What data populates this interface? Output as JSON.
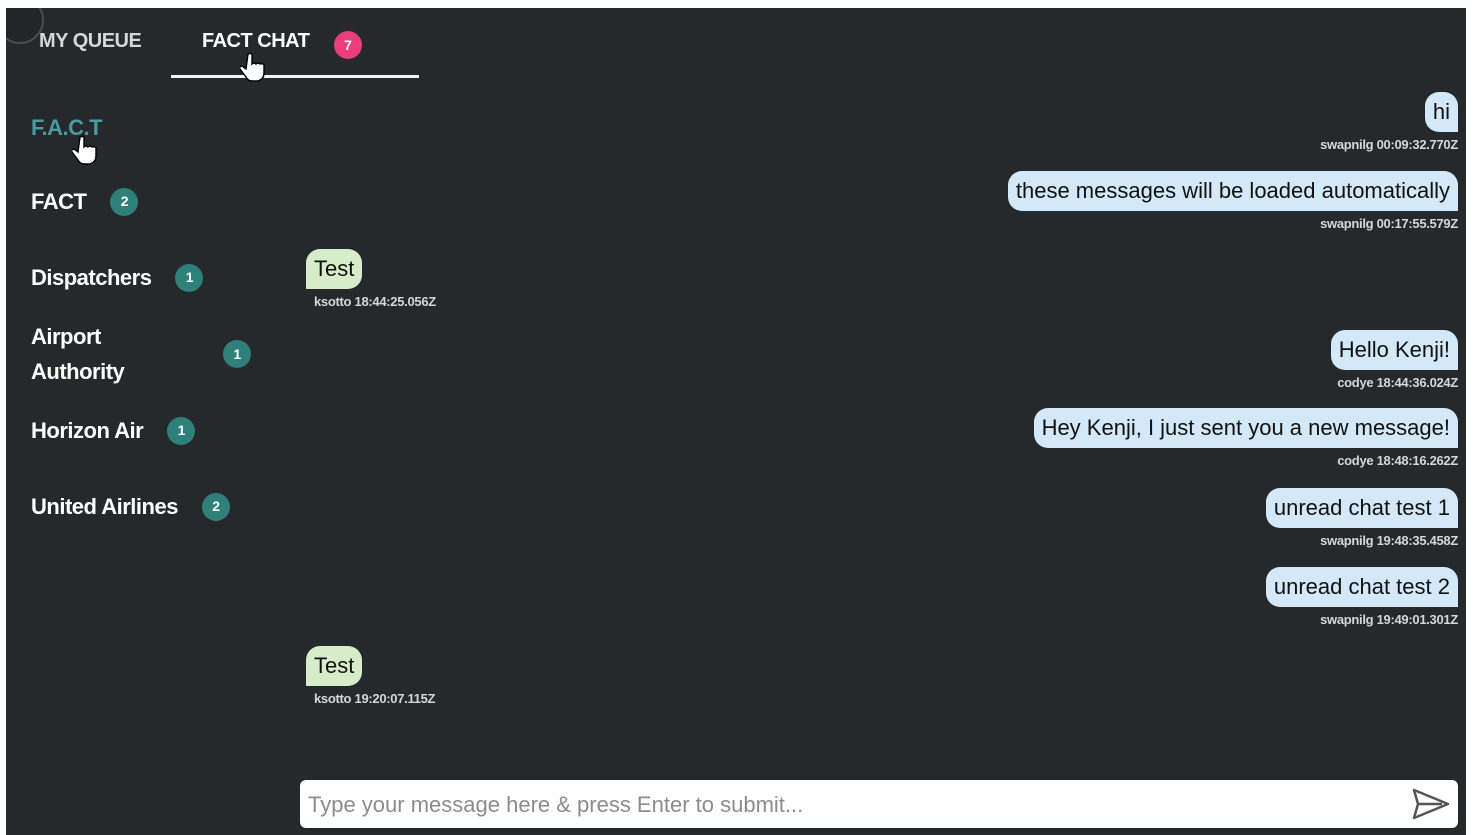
{
  "tabs": {
    "queue_label": "MY QUEUE",
    "chat_label": "FACT CHAT",
    "chat_badge": "7"
  },
  "sidebar": {
    "items": [
      {
        "label": "F.A.C.T",
        "count": null,
        "active": true
      },
      {
        "label": "FACT",
        "count": "2"
      },
      {
        "label": "Dispatchers",
        "count": "1"
      },
      {
        "label": "Airport Authority",
        "count": "1"
      },
      {
        "label": "Horizon Air",
        "count": "1"
      },
      {
        "label": "United Airlines",
        "count": "2"
      }
    ]
  },
  "messages": [
    {
      "text": "hi",
      "meta": "swapnilg 00:09:32.770Z",
      "side": "right"
    },
    {
      "text": "these messages will be loaded automatically",
      "meta": "swapnilg 00:17:55.579Z",
      "side": "right"
    },
    {
      "text": "Test",
      "meta": "ksotto 18:44:25.056Z",
      "side": "left"
    },
    {
      "text": "Hello Kenji!",
      "meta": "codye 18:44:36.024Z",
      "side": "right"
    },
    {
      "text": "Hey Kenji, I just sent you a new message!",
      "meta": "codye 18:48:16.262Z",
      "side": "right"
    },
    {
      "text": "unread chat test 1",
      "meta": "swapnilg 19:48:35.458Z",
      "side": "right"
    },
    {
      "text": "unread chat test 2",
      "meta": "swapnilg 19:49:01.301Z",
      "side": "right"
    },
    {
      "text": "Test",
      "meta": "ksotto 19:20:07.115Z",
      "side": "left"
    }
  ],
  "composer": {
    "placeholder": "Type your message here & press Enter to submit...",
    "value": "",
    "send_icon": "send-icon"
  },
  "colors": {
    "background": "#26292c",
    "accent_badge": "#ea3e7a",
    "count_badge": "#2f7f7a",
    "active_channel": "#4a9aa0",
    "outgoing_bubble": "#d3e8f8",
    "incoming_bubble": "#d7ecc9"
  }
}
